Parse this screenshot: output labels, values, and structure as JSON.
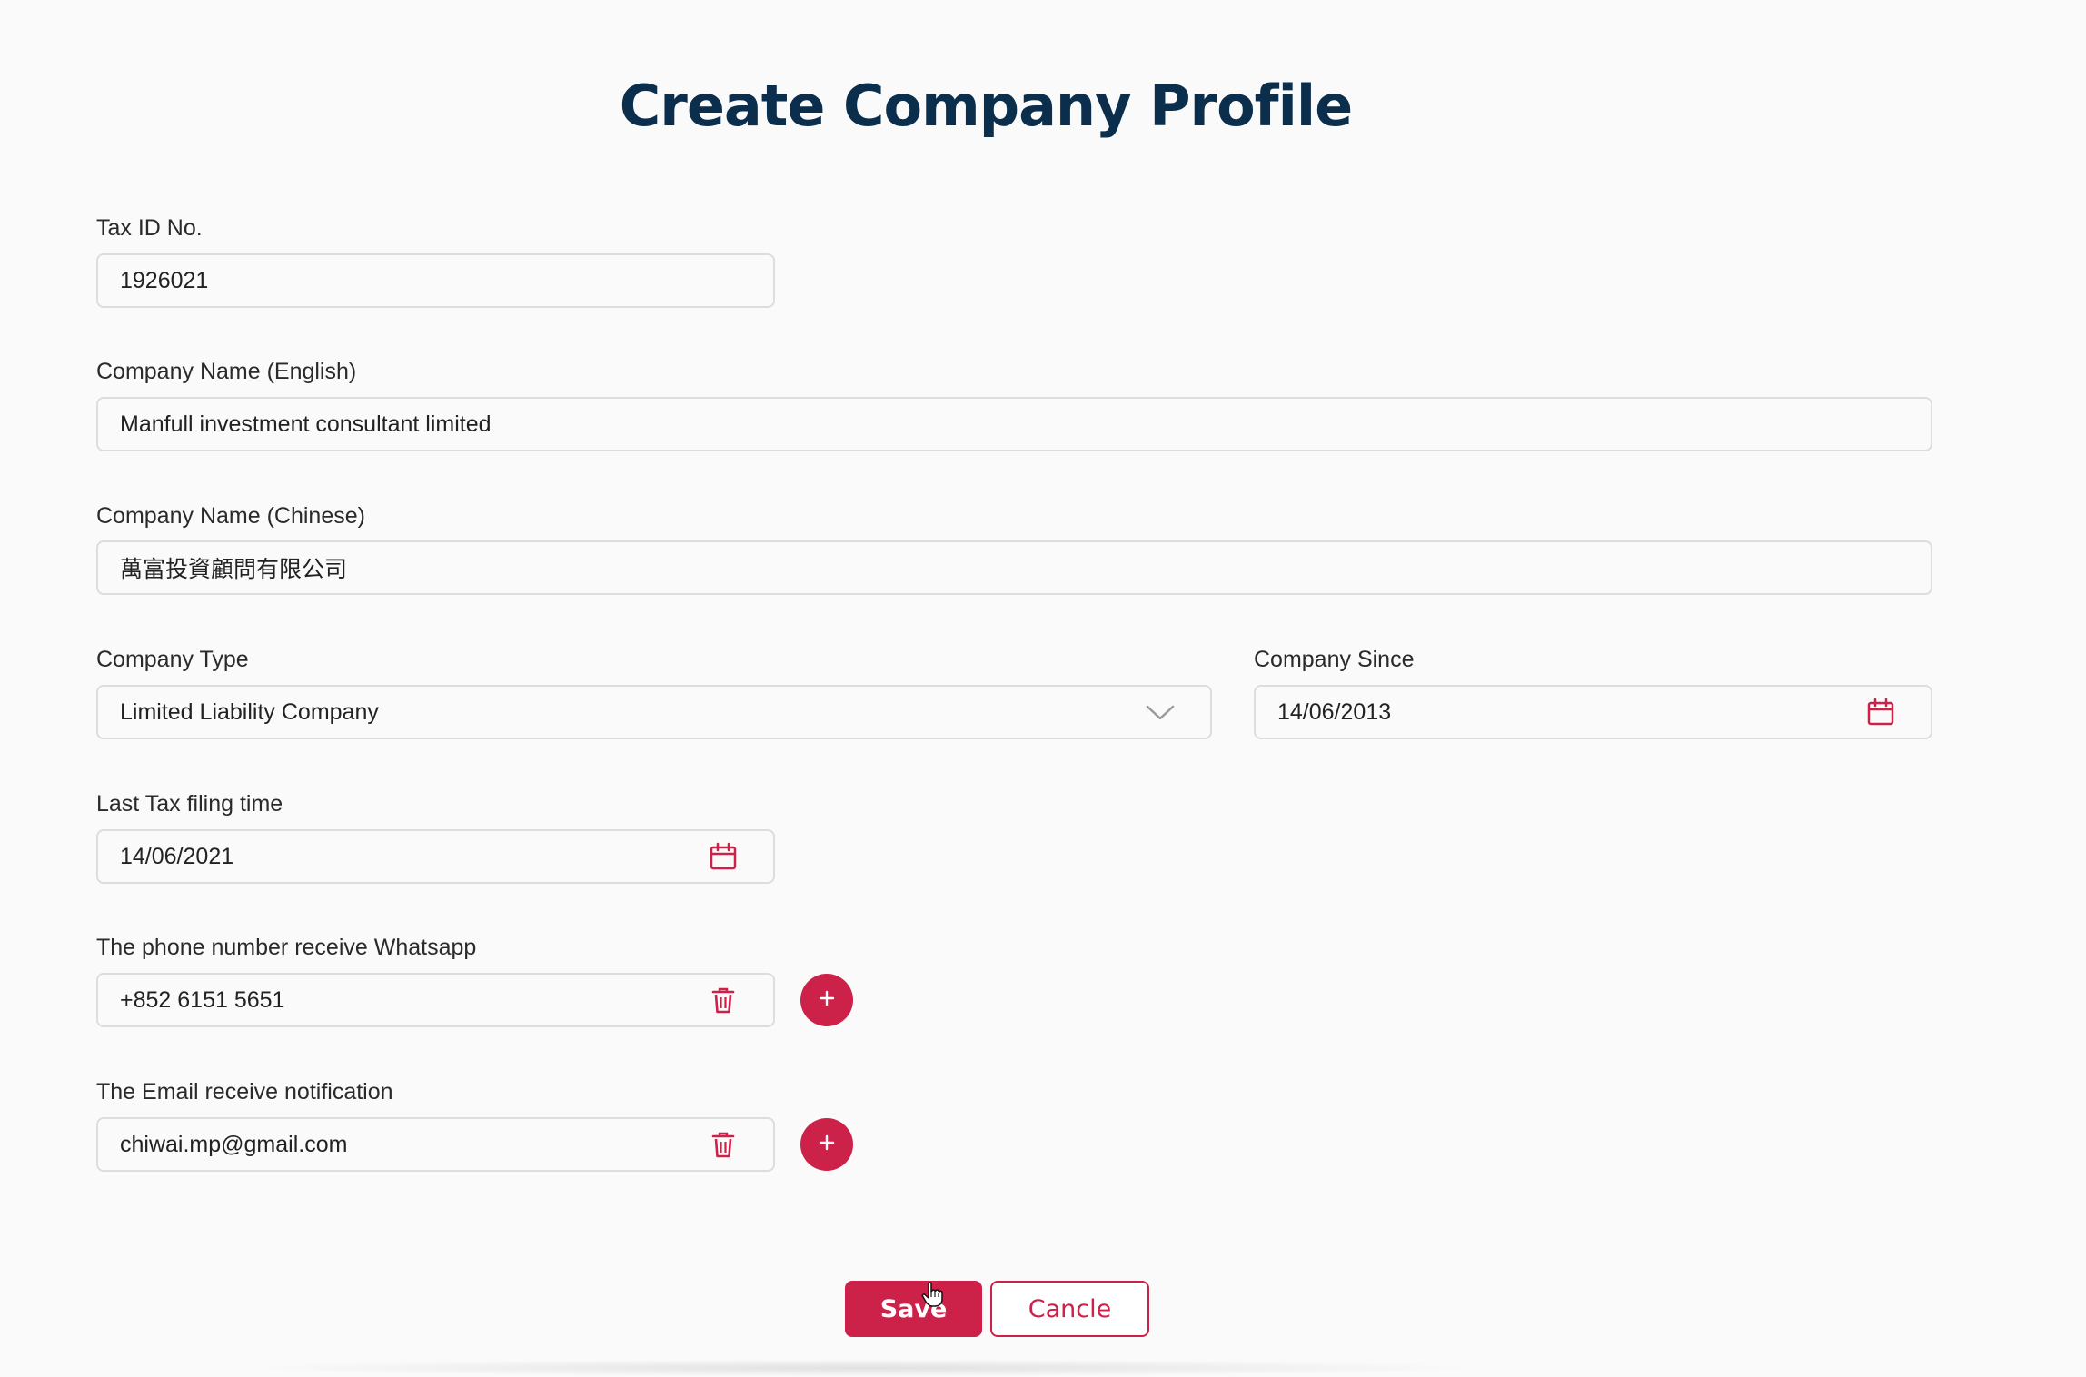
{
  "page": {
    "title": "Create Company Profile"
  },
  "theme": {
    "accent": "#cc2149",
    "title_color": "#0b2e4c",
    "background": "#fbfafb",
    "field_border": "#dedcde"
  },
  "form": {
    "tax_id": {
      "label": "Tax ID No.",
      "value": "1926021"
    },
    "company_name_english": {
      "label": "Company Name (English)",
      "value": "Manfull investment consultant limited"
    },
    "company_name_chinese": {
      "label": "Company Name (Chinese)",
      "value": "萬富投資顧問有限公司"
    },
    "company_type": {
      "label": "Company Type",
      "value": "Limited Liability Company",
      "icon": "chevron-down-icon"
    },
    "company_since": {
      "label": "Company Since",
      "value": "14/06/2013",
      "icon": "calendar-icon"
    },
    "last_tax_filing": {
      "label": "Last Tax filing time",
      "value": "14/06/2021",
      "icon": "calendar-icon"
    },
    "whatsapp_phone": {
      "label": "The phone number receive Whatsapp",
      "value": "+852 6151 5651",
      "icon": "trash-icon",
      "add_icon": "plus-icon"
    },
    "notification_email": {
      "label": "The Email receive notification",
      "value": "chiwai.mp@gmail.com",
      "icon": "trash-icon",
      "add_icon": "plus-icon"
    }
  },
  "actions": {
    "save_label": "Save",
    "cancel_label": "Cancle"
  }
}
